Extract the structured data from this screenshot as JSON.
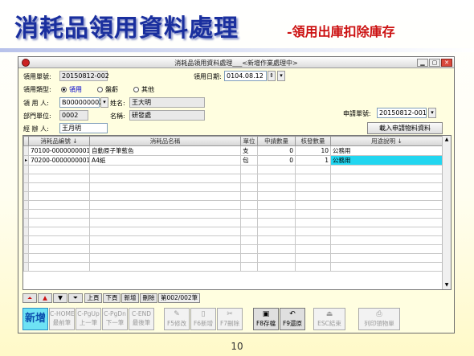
{
  "slide": {
    "title": "消耗品領用資料處理",
    "subtitle": "-領用出庫扣除庫存",
    "page_number": "10"
  },
  "window": {
    "title": "消耗品領用資料處理___<新增作業處理中>",
    "controls": [
      "▁",
      "▢",
      "✕"
    ]
  },
  "form": {
    "receipt_no_label": "領用單號:",
    "receipt_no": "20150812-002",
    "date_label": "領用日期:",
    "date": "0104.08.12",
    "type_label": "領用類型:",
    "type_options": [
      "領用",
      "盤虧",
      "其他"
    ],
    "type_selected_index": 0,
    "person_label": "領 用 人:",
    "person_code": "B000000002",
    "name_label": "姓名:",
    "person_name": "王大明",
    "dept_label": "部門單位:",
    "dept_code": "0002",
    "dept_name_label": "名稱:",
    "dept_name": "研發處",
    "handler_label": "經 辦 人:",
    "handler": "王月明",
    "request_no_label": "申請單號:",
    "request_no": "20150812-001",
    "load_button": "載入申請物料資料"
  },
  "grid": {
    "columns": [
      "消耗品編號 ↓",
      "消耗品名稱",
      "單位",
      "申請數量",
      "核發數量",
      "用途說明 ↓"
    ],
    "rows": [
      [
        "70100-0000000001",
        "自動原子筆藍色",
        "支",
        "0",
        "10",
        "公務用"
      ],
      [
        "70200-0000000001",
        "A4紙",
        "包",
        "0",
        "1",
        "公務用"
      ]
    ],
    "current_row_marker": "▸"
  },
  "nav": {
    "prev_page": "上頁",
    "next_page": "下頁",
    "add": "新增",
    "delete": "刪除",
    "page_count": "第002/002筆"
  },
  "toolbar": {
    "new": "新增",
    "first": "C-HOME\n最前筆",
    "prev": "C-PgUp\n上一筆",
    "next": "C-PgDn\n下一筆",
    "last": "C-END\n最後筆",
    "edit": "F5修改",
    "add": "F6新增",
    "delete": "F7刪除",
    "save": "F8存檔",
    "restore": "F9還原",
    "exit": "ESC結束",
    "print": "列印領物單"
  }
}
